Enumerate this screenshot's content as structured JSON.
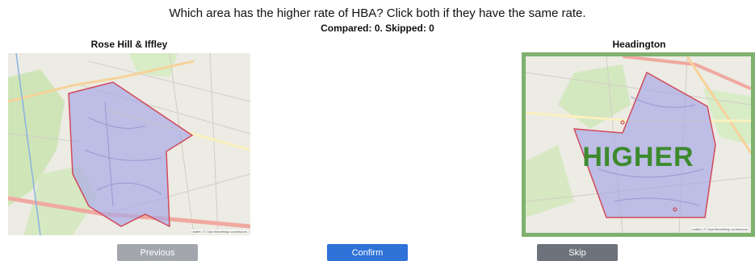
{
  "header": {
    "question": "Which area has the higher rate of HBA? Click both if they have the same rate.",
    "counter": "Compared: 0. Skipped: 0"
  },
  "left_area": {
    "title": "Rose Hill & Iffley",
    "attribution": "Leaflet | © OpenStreetMap contributors"
  },
  "right_area": {
    "title": "Headington",
    "selected_label": "HIGHER",
    "attribution": "Leaflet | © OpenStreetMap contributors"
  },
  "buttons": {
    "previous": "Previous",
    "confirm": "Confirm",
    "skip": "Skip"
  },
  "colors": {
    "region_fill": "#a9a9e6",
    "region_stroke": "#d24a5a",
    "selected_border": "#7fb16f",
    "higher_text": "#3d8a2e",
    "confirm_button": "#2f72d8",
    "previous_button": "#a3a7ad",
    "skip_button": "#6d737b"
  }
}
